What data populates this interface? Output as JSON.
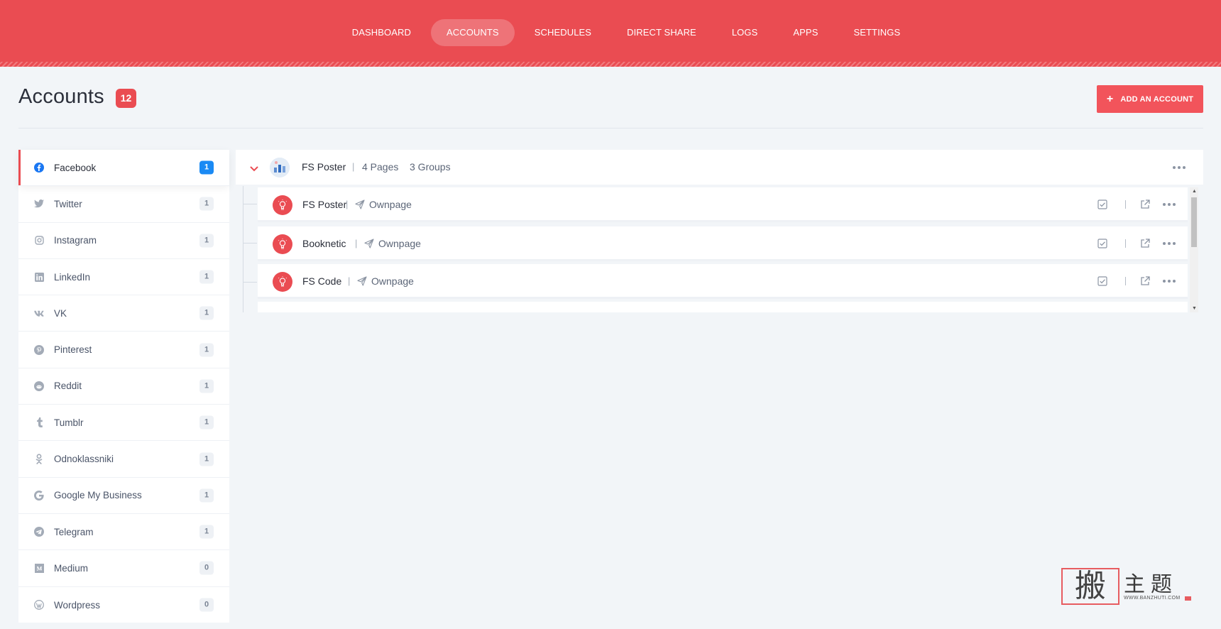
{
  "nav": {
    "items": [
      "DASHBOARD",
      "ACCOUNTS",
      "SCHEDULES",
      "DIRECT SHARE",
      "LOGS",
      "APPS",
      "SETTINGS"
    ],
    "active": "ACCOUNTS"
  },
  "header": {
    "title": "Accounts",
    "count": "12",
    "add_button": "ADD AN ACCOUNT"
  },
  "sidebar": {
    "items": [
      {
        "label": "Facebook",
        "count": "1",
        "icon": "facebook-icon"
      },
      {
        "label": "Twitter",
        "count": "1",
        "icon": "twitter-icon"
      },
      {
        "label": "Instagram",
        "count": "1",
        "icon": "instagram-icon"
      },
      {
        "label": "LinkedIn",
        "count": "1",
        "icon": "linkedin-icon"
      },
      {
        "label": "VK",
        "count": "1",
        "icon": "vk-icon"
      },
      {
        "label": "Pinterest",
        "count": "1",
        "icon": "pinterest-icon"
      },
      {
        "label": "Reddit",
        "count": "1",
        "icon": "reddit-icon"
      },
      {
        "label": "Tumblr",
        "count": "1",
        "icon": "tumblr-icon"
      },
      {
        "label": "Odnoklassniki",
        "count": "1",
        "icon": "odnoklassniki-icon"
      },
      {
        "label": "Google My Business",
        "count": "1",
        "icon": "google-icon"
      },
      {
        "label": "Telegram",
        "count": "1",
        "icon": "telegram-icon"
      },
      {
        "label": "Medium",
        "count": "0",
        "icon": "medium-icon"
      },
      {
        "label": "Wordpress",
        "count": "0",
        "icon": "wordpress-icon"
      }
    ]
  },
  "account": {
    "name": "FS Poster",
    "pages": "4 Pages",
    "groups": "3 Groups",
    "nodes": [
      {
        "name": "FS Poster",
        "type": "Ownpage"
      },
      {
        "name": "Booknetic",
        "type": "Ownpage"
      },
      {
        "name": "FS Code",
        "type": "Ownpage"
      }
    ]
  },
  "watermark": {
    "seal": "搬",
    "chars": "主题",
    "url": "WWW.BANZHUTI.COM"
  },
  "colors": {
    "brand": "#ea4c52",
    "active_count": "#1a8af4",
    "background": "#f2f5f8"
  }
}
